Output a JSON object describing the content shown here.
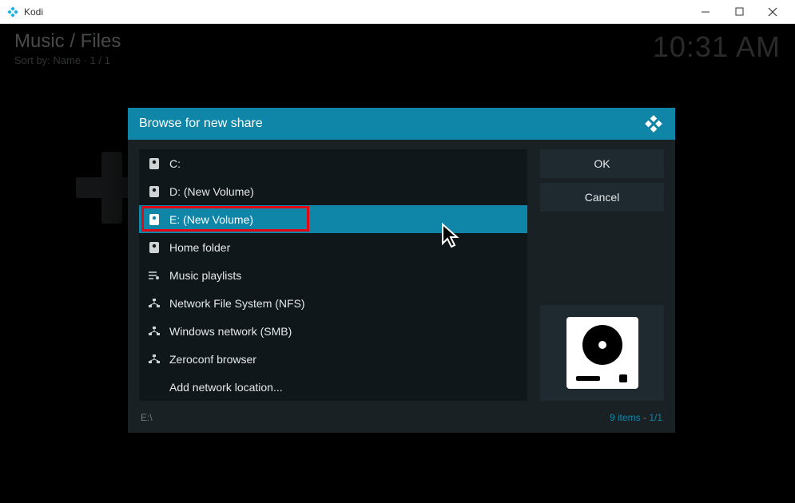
{
  "window": {
    "title": "Kodi"
  },
  "background": {
    "breadcrumb": "Music / Files",
    "sort_line": "Sort by: Name  ·  1 / 1",
    "time": "10:31 AM"
  },
  "dialog": {
    "title": "Browse for new share",
    "items": [
      {
        "icon": "drive",
        "label": "C:"
      },
      {
        "icon": "drive",
        "label": "D: (New Volume)"
      },
      {
        "icon": "drive",
        "label": "E: (New Volume)",
        "selected": true,
        "highlighted": true
      },
      {
        "icon": "drive",
        "label": "Home folder"
      },
      {
        "icon": "playlist",
        "label": "Music playlists"
      },
      {
        "icon": "network",
        "label": "Network File System (NFS)"
      },
      {
        "icon": "network",
        "label": "Windows network (SMB)"
      },
      {
        "icon": "network",
        "label": "Zeroconf browser"
      },
      {
        "icon": "none",
        "label": "Add network location..."
      }
    ],
    "buttons": {
      "ok": "OK",
      "cancel": "Cancel"
    },
    "footer": {
      "path": "E:\\",
      "count_label": "9 items",
      "page": "1/1"
    }
  }
}
